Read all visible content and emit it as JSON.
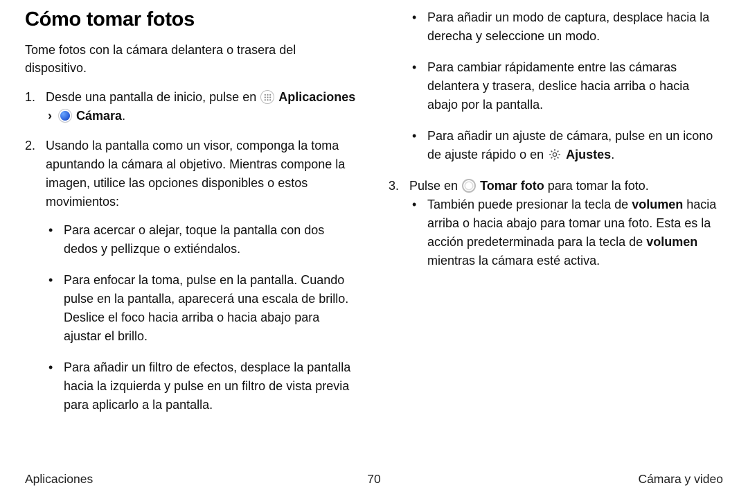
{
  "title": "Cómo tomar fotos",
  "intro": "Tome fotos con la cámara delantera o trasera del dispositivo.",
  "step1": {
    "pre": "Desde una pantalla de inicio, pulse en ",
    "apps": "Aplicaciones",
    "chev": "›",
    "camera": "Cámara",
    "post": "."
  },
  "step2": {
    "text": "Usando la pantalla como un visor, componga la toma apuntando la cámara al objetivo. Mientras compone la imagen, utilice las opciones disponibles o estos movimientos:",
    "bullets_left": [
      "Para acercar o alejar, toque la pantalla con dos dedos y pellizque o extiéndalos.",
      "Para enfocar la toma, pulse en la pantalla. Cuando pulse en la pantalla, aparecerá una escala de brillo. Deslice el foco hacia arriba o hacia abajo para ajustar el brillo.",
      "Para añadir un filtro de efectos, desplace la pantalla hacia la izquierda y pulse en un filtro de vista previa para aplicarlo a la pantalla."
    ],
    "bullets_right": [
      "Para añadir un modo de captura, desplace hacia la derecha y seleccione un modo.",
      "Para cambiar rápidamente entre las cámaras delantera y trasera, deslice hacia arriba o hacia abajo por la pantalla."
    ],
    "bullet_settings": {
      "pre": "Para añadir un ajuste de cámara, pulse en un icono de ajuste rápido o en ",
      "label": "Ajustes",
      "post": "."
    }
  },
  "step3": {
    "pre": "Pulse en ",
    "label": "Tomar foto",
    "post": " para tomar la foto.",
    "sub_pre": "También puede presionar la tecla de ",
    "vol1": "volumen",
    "mid": " hacia arriba o hacia abajo para tomar una foto. Esta es la acción predeterminada para la tecla de ",
    "vol2": "volumen",
    "end": " mientras la cámara esté activa."
  },
  "footer": {
    "left": "Aplicaciones",
    "center": "70",
    "right": "Cámara y video"
  }
}
